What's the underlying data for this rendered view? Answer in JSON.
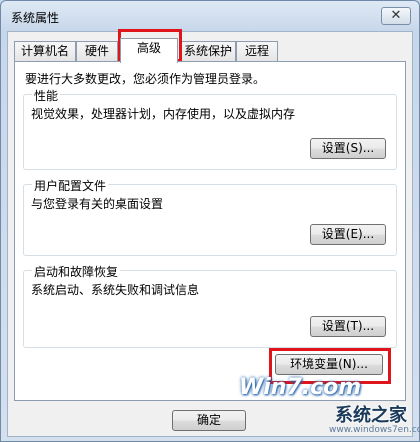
{
  "window": {
    "title": "系统属性",
    "close_symbol": "✕"
  },
  "tabs": [
    {
      "label": "计算机名"
    },
    {
      "label": "硬件"
    },
    {
      "label": "高级",
      "active": true
    },
    {
      "label": "系统保护"
    },
    {
      "label": "远程"
    }
  ],
  "intro": "要进行大多数更改，您必须作为管理员登录。",
  "groups": {
    "performance": {
      "title": "性能",
      "desc": "视觉效果，处理器计划，内存使用，以及虚拟内存",
      "button": "设置(S)..."
    },
    "profiles": {
      "title": "用户配置文件",
      "desc": "与您登录有关的桌面设置",
      "button": "设置(E)..."
    },
    "startup": {
      "title": "启动和故障恢复",
      "desc": "系统启动、系统失败和调试信息",
      "button": "设置(T)..."
    }
  },
  "env_button": "环境变量(N)...",
  "footer": {
    "ok": "确定"
  },
  "watermark": {
    "logo": "Win7.com",
    "name": "系统之家",
    "url": "www.windows7en.com"
  },
  "colors": {
    "highlight": "#e0151c",
    "accent": "#1f5fa8"
  }
}
